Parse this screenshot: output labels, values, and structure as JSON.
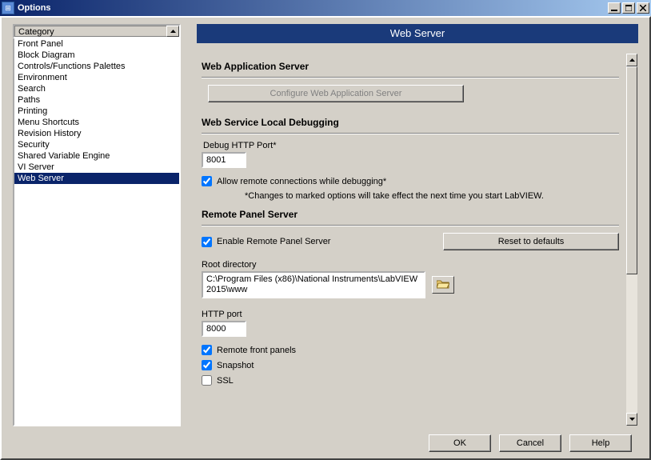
{
  "window": {
    "title": "Options"
  },
  "category": {
    "header": "Category",
    "items": [
      "Front Panel",
      "Block Diagram",
      "Controls/Functions Palettes",
      "Environment",
      "Search",
      "Paths",
      "Printing",
      "Menu Shortcuts",
      "Revision History",
      "Security",
      "Shared Variable Engine",
      "VI Server",
      "Web Server"
    ],
    "selected_index": 12
  },
  "page": {
    "title": "Web Server",
    "web_app": {
      "heading": "Web Application Server",
      "configure_btn": "Configure Web Application Server"
    },
    "debug": {
      "heading": "Web Service Local Debugging",
      "port_label": "Debug HTTP Port*",
      "port_value": "8001",
      "allow_remote_label": "Allow remote connections while debugging*",
      "allow_remote_checked": true,
      "note": "*Changes to marked options will take effect the next time you start LabVIEW."
    },
    "remote": {
      "heading": "Remote Panel Server",
      "enable_label": "Enable Remote Panel Server",
      "enable_checked": true,
      "reset_btn": "Reset to defaults",
      "rootdir_label": "Root directory",
      "rootdir_value": "C:\\Program Files (x86)\\National Instruments\\LabVIEW 2015\\www",
      "http_port_label": "HTTP port",
      "http_port_value": "8000",
      "remote_front_label": "Remote front panels",
      "remote_front_checked": true,
      "snapshot_label": "Snapshot",
      "snapshot_checked": true,
      "ssl_label": "SSL",
      "ssl_checked": false
    }
  },
  "buttons": {
    "ok": "OK",
    "cancel": "Cancel",
    "help": "Help"
  }
}
